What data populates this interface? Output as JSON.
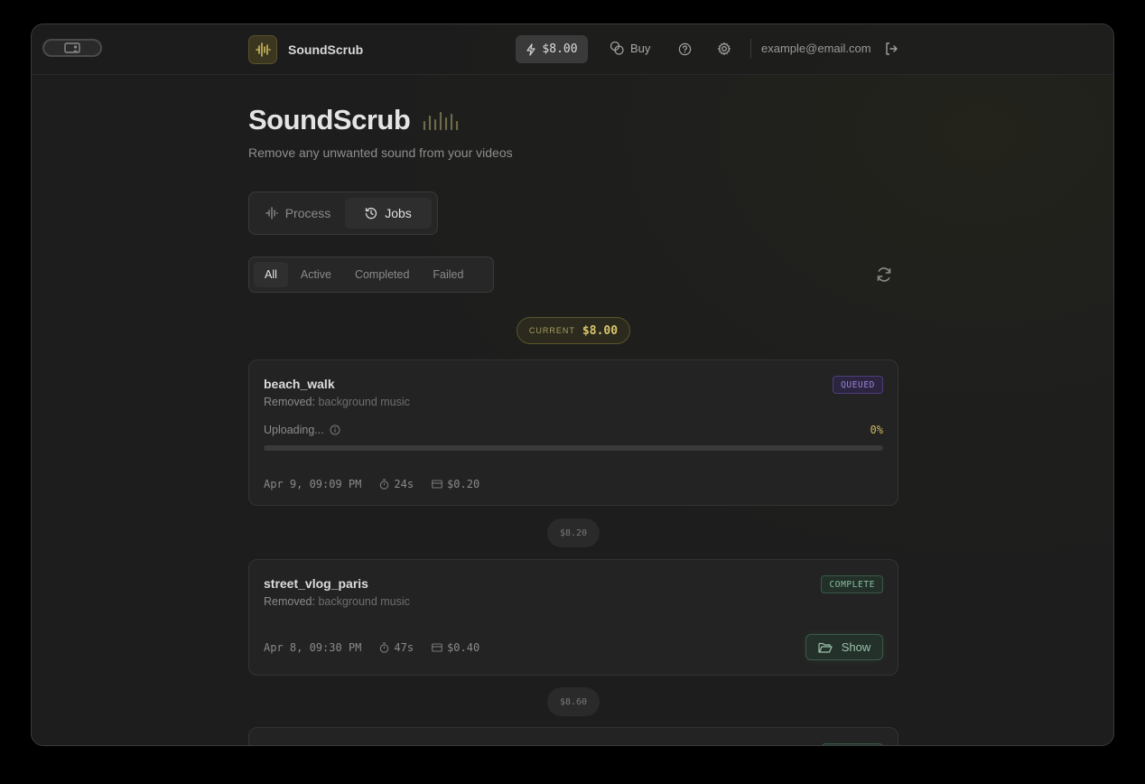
{
  "app": {
    "name": "SoundScrub"
  },
  "header": {
    "credit": "$8.00",
    "buy_label": "Buy",
    "email": "example@email.com"
  },
  "hero": {
    "title": "SoundScrub",
    "subtitle": "Remove any unwanted sound from your videos"
  },
  "mode_tabs": [
    {
      "label": "Process",
      "active": false
    },
    {
      "label": "Jobs",
      "active": true
    }
  ],
  "filters": [
    {
      "label": "All",
      "active": true
    },
    {
      "label": "Active",
      "active": false
    },
    {
      "label": "Completed",
      "active": false
    },
    {
      "label": "Failed",
      "active": false
    }
  ],
  "current": {
    "label": "CURRENT",
    "value": "$8.00"
  },
  "jobs": [
    {
      "name": "beach_walk",
      "removed_prefix": "Removed:",
      "removed_what": "background music",
      "status": "QUEUED",
      "progress_label": "Uploading...",
      "progress_pct": "0%",
      "progress": 0,
      "date": "Apr 9, 09:09 PM",
      "duration": "24s",
      "cost": "$0.20"
    },
    {
      "name": "street_vlog_paris",
      "removed_prefix": "Removed:",
      "removed_what": "background music",
      "status": "COMPLETE",
      "date": "Apr 8, 09:30 PM",
      "duration": "47s",
      "cost": "$0.40",
      "action_label": "Show"
    }
  ],
  "spent_markers": [
    "$8.20",
    "$8.60"
  ],
  "colors": {
    "accent": "#cdbb5e",
    "queued": "#9a82d8",
    "complete": "#8bbfa0"
  }
}
